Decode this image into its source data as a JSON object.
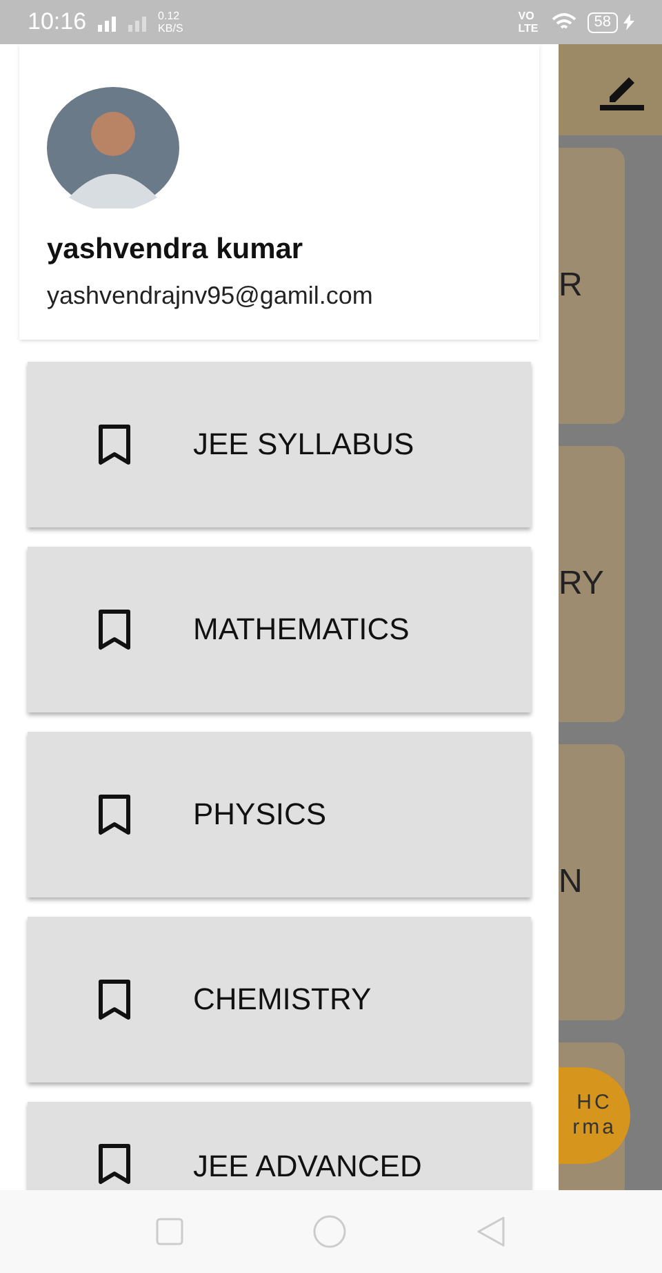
{
  "status_bar": {
    "time": "10:16",
    "speed": "0.12 KB/S",
    "network": "VO LTE",
    "battery": "58"
  },
  "drawer": {
    "user": {
      "name": "yashvendra kumar",
      "email": "yashvendrajnv95@gamil.com"
    },
    "items": [
      {
        "label": "JEE SYLLABUS"
      },
      {
        "label": "MATHEMATICS"
      },
      {
        "label": "PHYSICS"
      },
      {
        "label": "CHEMISTRY"
      },
      {
        "label": "JEE ADVANCED"
      }
    ]
  },
  "background": {
    "cards": [
      {
        "text": "R"
      },
      {
        "text": "RY"
      },
      {
        "text": "N"
      }
    ],
    "fab_lines": [
      "HC",
      "rma"
    ]
  }
}
